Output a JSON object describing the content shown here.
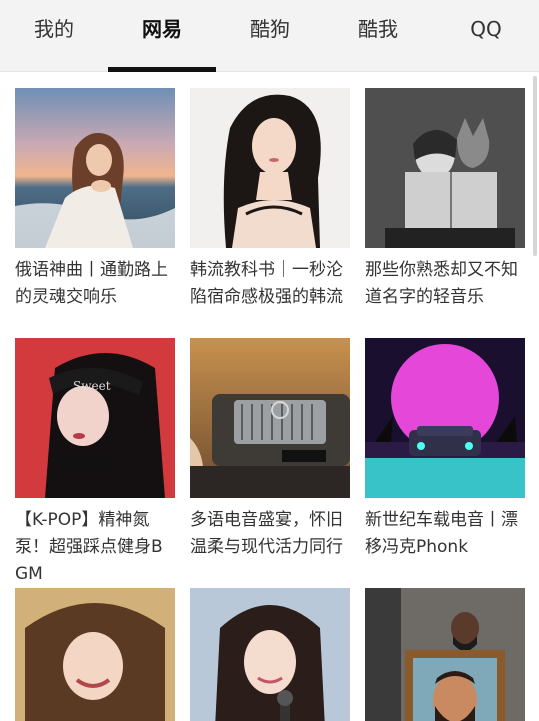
{
  "tabs": [
    {
      "label": "我的",
      "active": false
    },
    {
      "label": "网易",
      "active": true
    },
    {
      "label": "酷狗",
      "active": false
    },
    {
      "label": "酷我",
      "active": false
    },
    {
      "label": "QQ",
      "active": false
    }
  ],
  "playlists": [
    {
      "title": "俄语神曲丨通勤路上的灵魂交响乐",
      "cover": "beach-girl-cover"
    },
    {
      "title": "韩流教科书｜一秒沦陷宿命感极强的韩流",
      "cover": "korean-woman-cover"
    },
    {
      "title": "那些你熟悉却又不知道名字的轻音乐",
      "cover": "girl-and-cat-book-cover"
    },
    {
      "title": "【K-POP】精神氮泵！超强踩点健身BGM",
      "cover": "kpop-idol-cover"
    },
    {
      "title": "多语电音盛宴，怀旧温柔与现代活力同行",
      "cover": "vintage-car-cover"
    },
    {
      "title": "新世纪车载电音丨漂移冯克Phonk",
      "cover": "synthwave-car-cover"
    },
    {
      "title": "",
      "cover": "smiling-girl-cover"
    },
    {
      "title": "",
      "cover": "actress-microphone-cover"
    },
    {
      "title": "",
      "cover": "bearded-man-portrait-cover"
    }
  ],
  "colors": {
    "tabbar_bg": "#f3f3f3",
    "active_indicator": "#111111",
    "text": "#333333"
  }
}
